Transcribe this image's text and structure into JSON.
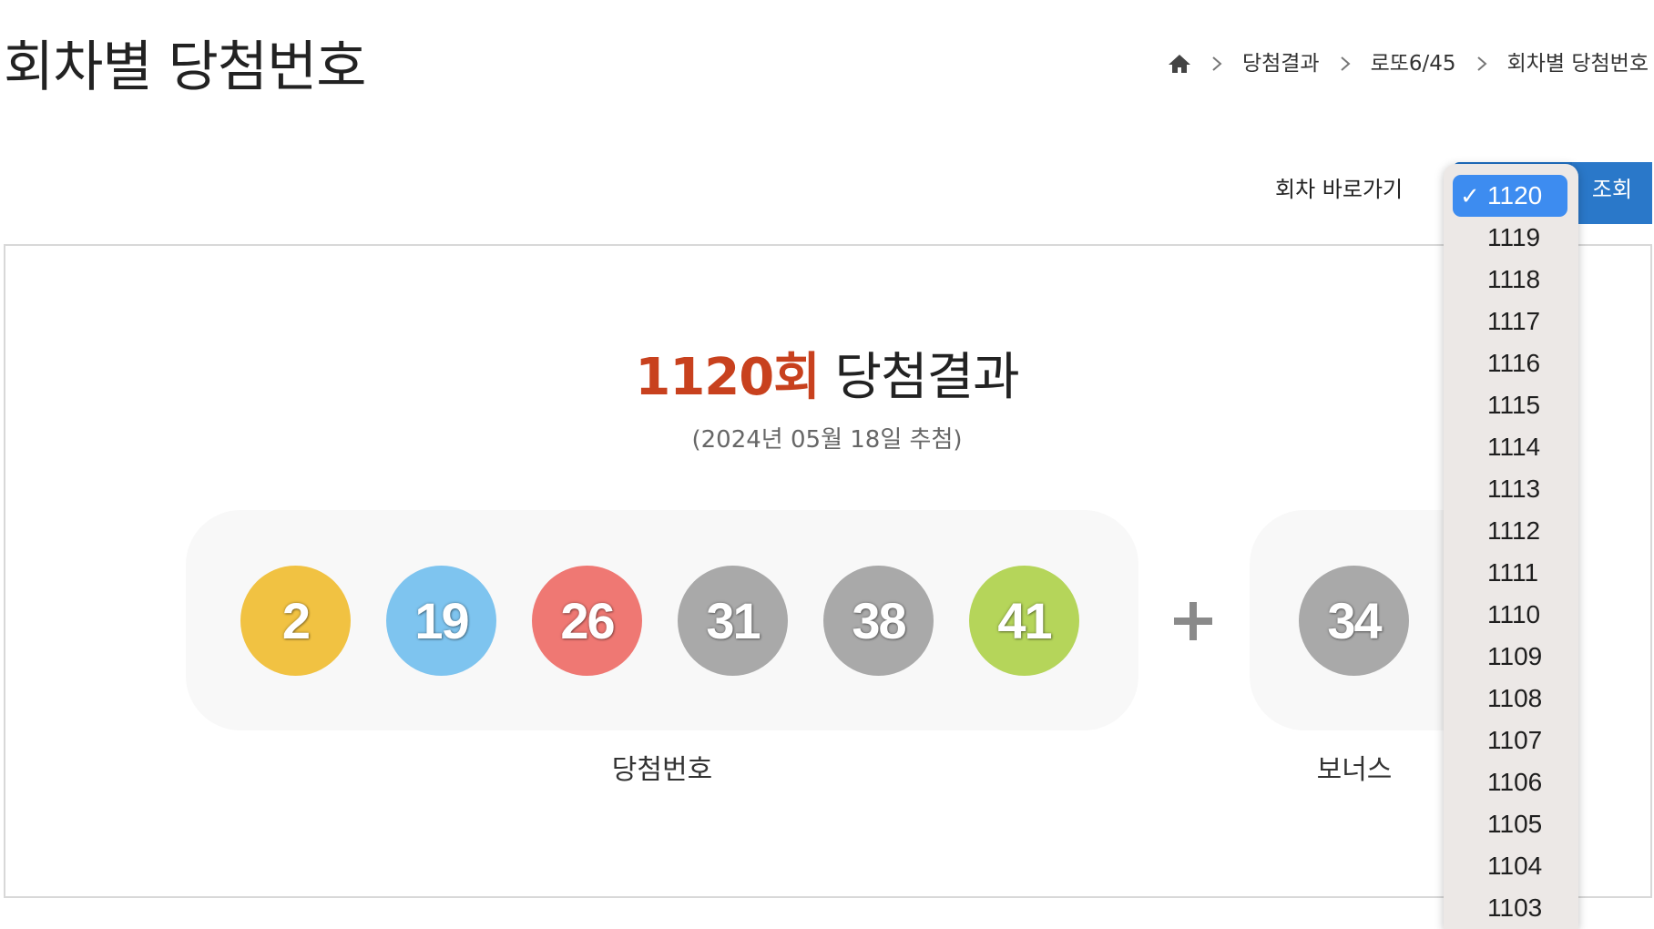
{
  "page": {
    "title": "회차별 당첨번호"
  },
  "breadcrumb": {
    "items": [
      "당첨결과",
      "로또6/45",
      "회차별 당첨번호"
    ]
  },
  "draw_picker": {
    "label": "회차 바로가기",
    "selected": "1120",
    "search_label": "조회",
    "options": [
      "1120",
      "1119",
      "1118",
      "1117",
      "1116",
      "1115",
      "1114",
      "1113",
      "1112",
      "1111",
      "1110",
      "1109",
      "1108",
      "1107",
      "1106",
      "1105",
      "1104",
      "1103"
    ]
  },
  "result": {
    "round": "1120회",
    "heading_suffix": " 당첨결과",
    "date": "(2024년 05월 18일 추첨)",
    "winning_label": "당첨번호",
    "bonus_label": "보너스",
    "numbers": [
      {
        "value": "2",
        "color": "#f1c242"
      },
      {
        "value": "19",
        "color": "#7ec4ef"
      },
      {
        "value": "26",
        "color": "#ef7873"
      },
      {
        "value": "31",
        "color": "#a9a9a9"
      },
      {
        "value": "38",
        "color": "#a9a9a9"
      },
      {
        "value": "41",
        "color": "#b5d55a"
      }
    ],
    "bonus": {
      "value": "34",
      "color": "#a9a9a9"
    }
  },
  "colors": {
    "accent_round": "#c8411e",
    "button_blue": "#2a78c9",
    "selected_option": "#3d8cf0"
  }
}
